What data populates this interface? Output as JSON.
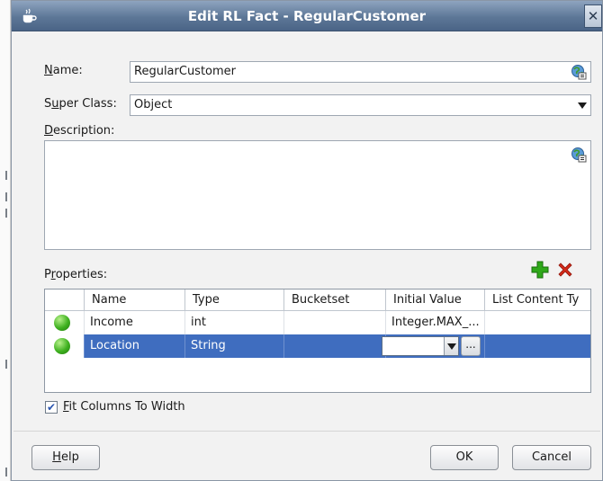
{
  "dialog": {
    "title": "Edit RL Fact - RegularCustomer",
    "close_glyph": "✕",
    "app_icon": "java-cup-icon"
  },
  "form": {
    "name_label": "Name:",
    "name_mnemonic": "N",
    "name_label_rest": "ame:",
    "name_value": "RegularCustomer",
    "superclass_label_pre": "S",
    "superclass_label_mnemonic": "u",
    "superclass_label_rest": "per Class:",
    "superclass_value": "Object",
    "description_mnemonic": "D",
    "description_label_rest": "escription:",
    "description_value": "",
    "translate_icon": "globe-translate-icon"
  },
  "properties": {
    "label_pre": "P",
    "label_mnemonic": "r",
    "label_rest": "operties:",
    "add_icon": "add-plus-icon",
    "delete_icon": "delete-x-icon",
    "columns": [
      "Name",
      "Type",
      "Bucketset",
      "Initial Value",
      "List Content Ty"
    ],
    "rows": [
      {
        "status": "valid",
        "name": "Income",
        "type": "int",
        "bucketset": "",
        "initial_value": "Integer.MAX_...",
        "list_content_type": ""
      },
      {
        "status": "valid",
        "name": "Location",
        "type": "String",
        "bucketset": "",
        "initial_value": "",
        "list_content_type": "",
        "selected": true
      }
    ],
    "ellipsis": "..."
  },
  "options": {
    "fit_columns_mnemonic": "F",
    "fit_columns_label_rest": "it Columns To Width",
    "fit_columns_checked": true,
    "check_glyph": "✔"
  },
  "buttons": {
    "help_mnemonic": "H",
    "help_rest": "elp",
    "ok": "OK",
    "cancel": "Cancel"
  },
  "colors": {
    "title_bar": "#5d7797",
    "selection": "#3f6dbf",
    "status_green": "#3fb120",
    "add_green": "#2fa81a",
    "delete_red": "#d42a1a"
  }
}
